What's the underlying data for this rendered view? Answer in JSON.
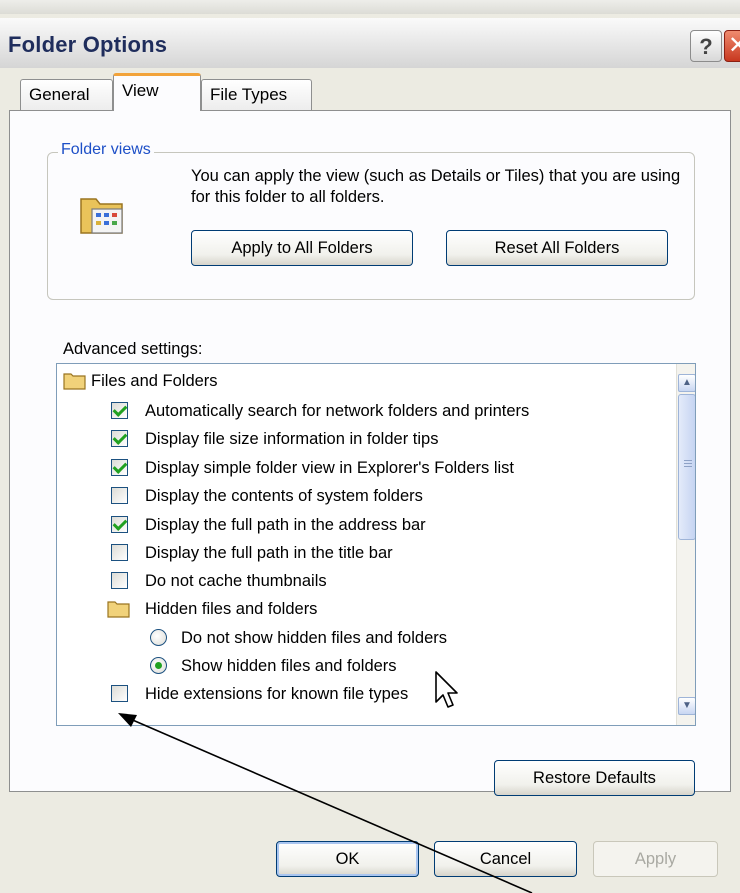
{
  "window": {
    "title": "Folder Options",
    "help_glyph": "?",
    "close_glyph": "✕"
  },
  "tabs": [
    {
      "label": "General",
      "active": false
    },
    {
      "label": "View",
      "active": true
    },
    {
      "label": "File Types",
      "active": false
    }
  ],
  "folder_views": {
    "label": "Folder views",
    "description": "You can apply the view (such as Details or Tiles) that you are using for this folder to all folders.",
    "apply_button": "Apply to All Folders",
    "reset_button": "Reset All Folders"
  },
  "advanced": {
    "label": "Advanced settings:",
    "items": [
      {
        "type": "folder",
        "label": "Files and Folders"
      },
      {
        "type": "checkbox",
        "checked": true,
        "label": "Automatically search for network folders and printers"
      },
      {
        "type": "checkbox",
        "checked": true,
        "label": "Display file size information in folder tips"
      },
      {
        "type": "checkbox",
        "checked": true,
        "label": "Display simple folder view in Explorer's Folders list"
      },
      {
        "type": "checkbox",
        "checked": false,
        "label": "Display the contents of system folders"
      },
      {
        "type": "checkbox",
        "checked": true,
        "label": "Display the full path in the address bar"
      },
      {
        "type": "checkbox",
        "checked": false,
        "label": "Display the full path in the title bar"
      },
      {
        "type": "checkbox",
        "checked": false,
        "label": "Do not cache thumbnails"
      },
      {
        "type": "folder",
        "label": "Hidden files and folders"
      },
      {
        "type": "radio",
        "checked": false,
        "label": "Do not show hidden files and folders"
      },
      {
        "type": "radio",
        "checked": true,
        "label": "Show hidden files and folders"
      },
      {
        "type": "checkbox",
        "checked": false,
        "label": "Hide extensions for known file types"
      }
    ]
  },
  "restore_button": "Restore Defaults",
  "footer": {
    "ok": "OK",
    "cancel": "Cancel",
    "apply": "Apply"
  },
  "colors": {
    "title_text": "#1f2d5c",
    "groupbox_label": "#1d4fc7",
    "check_mark": "#21a121",
    "active_tab_accent": "#f2a33a"
  },
  "icons": {
    "help": "help-icon",
    "close": "close-icon",
    "folder_views": "folder-views-icon",
    "folder": "folder-icon",
    "scroll_up": "scroll-up-arrow-icon",
    "scroll_down": "scroll-down-arrow-icon",
    "cursor": "mouse-pointer-icon",
    "annotation": "annotation-arrow-icon"
  }
}
